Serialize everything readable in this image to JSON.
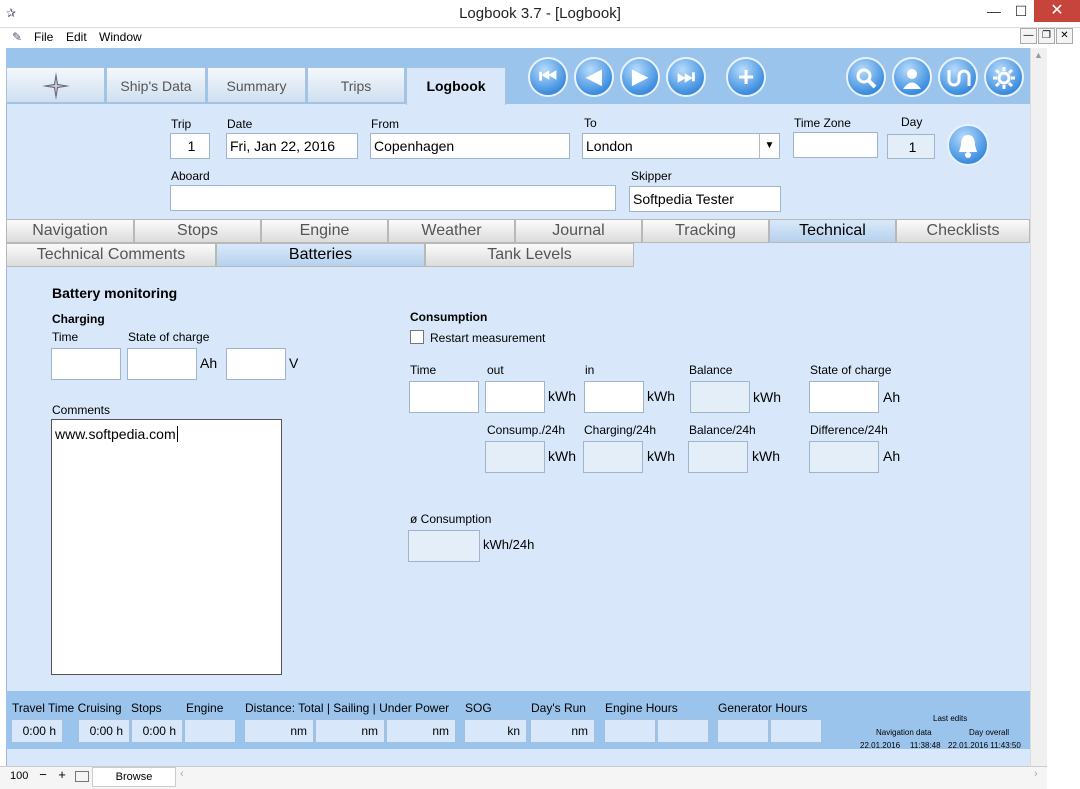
{
  "window": {
    "title": "Logbook 3.7 - [Logbook]",
    "minimize": "—",
    "maximize": "☐",
    "close": "✕",
    "restore": "❐"
  },
  "menu": [
    "File",
    "Edit",
    "Window"
  ],
  "tabs": {
    "main": [
      "Ship's Data",
      "Summary",
      "Trips",
      "Logbook"
    ],
    "active": "Logbook"
  },
  "icons": [
    "compass-rose-icon",
    "first-record-icon",
    "previous-record-icon",
    "next-record-icon",
    "last-record-icon",
    "add-record-icon",
    "search-icon",
    "user-icon",
    "sync-icon",
    "settings-icon",
    "bell-icon"
  ],
  "header": {
    "trip": {
      "label": "Trip",
      "value": "1"
    },
    "date": {
      "label": "Date",
      "value": "Fri, Jan 22, 2016"
    },
    "from": {
      "label": "From",
      "value": "Copenhagen"
    },
    "to": {
      "label": "To",
      "value": "London"
    },
    "timezone": {
      "label": "Time Zone",
      "value": ""
    },
    "day": {
      "label": "Day",
      "value": "1"
    },
    "aboard": {
      "label": "Aboard",
      "value": ""
    },
    "skipper": {
      "label": "Skipper",
      "value": "Softpedia Tester"
    }
  },
  "section_tabs": [
    "Navigation",
    "Stops",
    "Engine",
    "Weather",
    "Journal",
    "Tracking",
    "Technical",
    "Checklists"
  ],
  "sub_tabs": [
    "Technical Comments",
    "Batteries",
    "Tank Levels"
  ],
  "battery": {
    "title": "Battery monitoring",
    "charging": {
      "title": "Charging",
      "time": "Time",
      "soc": "State of charge",
      "unit_ah": "Ah",
      "unit_v": "V"
    },
    "comments": {
      "label": "Comments",
      "value": "www.softpedia.com"
    },
    "consumption": {
      "title": "Consumption",
      "restart": "Restart measurement",
      "time": "Time",
      "out": "out",
      "in": "in",
      "balance": "Balance",
      "soc": "State of charge",
      "consump24": "Consump./24h",
      "charging24": "Charging/24h",
      "balance24": "Balance/24h",
      "difference24": "Difference/24h",
      "kwh": "kWh",
      "ah": "Ah",
      "avg": "ø Consumption",
      "avg_unit": "kWh/24h"
    }
  },
  "footer": {
    "travel_time": "Travel Time Cruising",
    "stops": "Stops",
    "engine": "Engine",
    "distance": "Distance: Total | Sailing | Under Power",
    "sog": "SOG",
    "days_run": "Day's Run",
    "engine_hours": "Engine Hours",
    "generator_hours": "Generator Hours",
    "travel_val": "0:00 h",
    "stops_val1": "0:00 h",
    "stops_val2": "0:00 h",
    "nm": "nm",
    "kn": "kn",
    "last_edits": "Last edits",
    "nav_data": "Navigation data",
    "day_overall": "Day overall",
    "nav_date": "22.01.2016",
    "nav_time": "11:38:48",
    "day_datetime": "22.01.2016 11:43:50"
  },
  "status": {
    "zoom": "100",
    "mode": "Browse"
  },
  "colors": {
    "header": "#9bc4ec",
    "content": "#d8e8fa",
    "active_tab": "#b6d1ee",
    "button": "#3f8fe0",
    "close": "#c7443c"
  }
}
